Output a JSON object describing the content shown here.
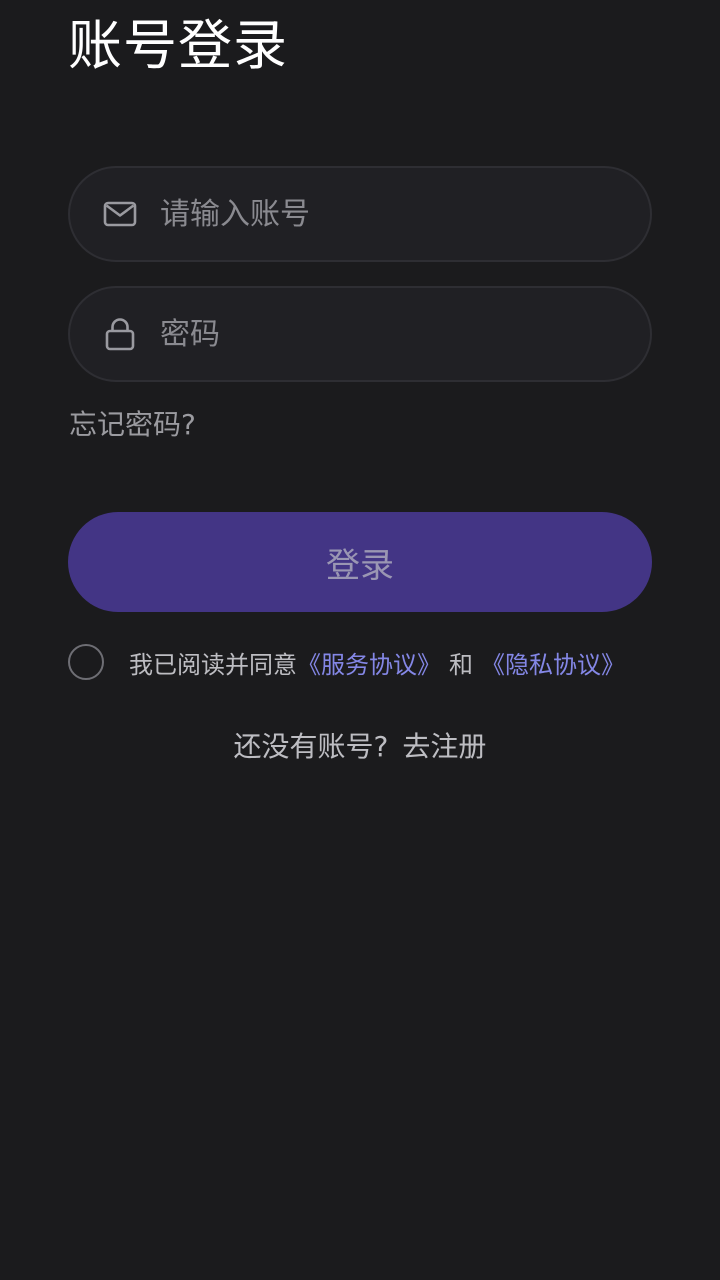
{
  "header": {
    "title": "账号登录"
  },
  "form": {
    "account": {
      "placeholder": "请输入账号",
      "value": "",
      "icon": "mail-icon"
    },
    "password": {
      "placeholder": "密码",
      "value": "",
      "icon": "lock-icon"
    },
    "forgot_label": "忘记密码?",
    "login_label": "登录"
  },
  "agreement": {
    "checked": false,
    "prefix": "我已阅读并同意",
    "service_link": "《服务协议》",
    "and": "和",
    "privacy_link": "《隐私协议》"
  },
  "register": {
    "prompt": "还没有账号?",
    "link": "去注册"
  },
  "colors": {
    "background": "#1b1b1d",
    "field_background": "#202024",
    "button": "#433585",
    "link": "#8487e6"
  }
}
